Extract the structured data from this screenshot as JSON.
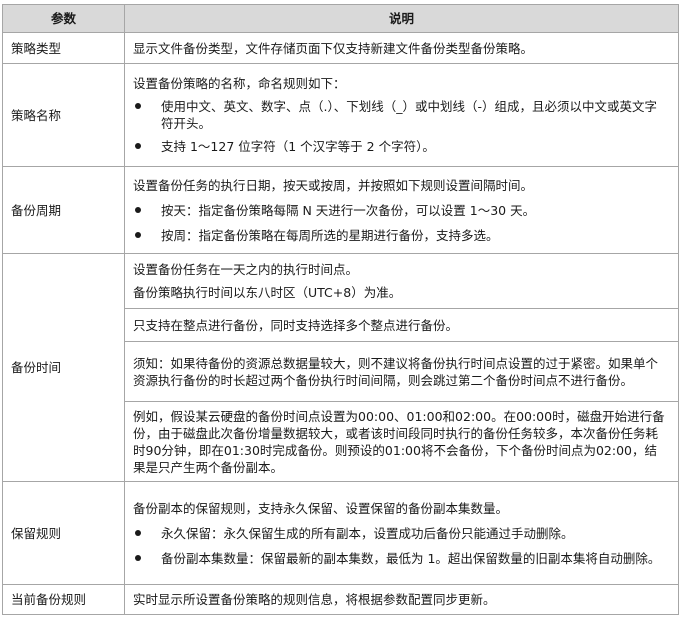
{
  "table": {
    "headers": [
      "参数",
      "说明"
    ],
    "rows": [
      {
        "param": "策略类型",
        "desc": "显示文件备份类型，文件存储页面下仅支持新建文件备份类型备份策略。"
      },
      {
        "param": "策略名称",
        "intro": "设置备份策略的名称，命名规则如下：",
        "bullets": [
          "使用中文、英文、数字、点（.）、下划线（_）或中划线（-）组成，且必须以中文或英文字符开头。",
          "支持 1～127 位字符（1 个汉字等于 2 个字符）。"
        ]
      },
      {
        "param": "备份周期",
        "intro": "设置备份任务的执行日期，按天或按周，并按照如下规则设置间隔时间。",
        "bullets": [
          "按天：指定备份策略每隔 N 天进行一次备份，可以设置 1～30 天。",
          "按周：指定备份策略在每周所选的星期进行备份，支持多选。"
        ]
      },
      {
        "param": "备份时间",
        "sub1_line1": "设置备份任务在一天之内的执行时间点。",
        "sub1_line2": "备份策略执行时间以东八时区（UTC+8）为准。",
        "sub2": "只支持在整点进行备份，同时支持选择多个整点进行备份。",
        "note": "须知：如果待备份的资源总数据量较大，则不建议将备份执行时间点设置的过于紧密。如果单个资源执行备份的时长超过两个备份执行时间间隔，则会跳过第二个备份时间点不进行备份。",
        "example": "例如，假设某云硬盘的备份时间点设置为00:00、01:00和02:00。在00:00时，磁盘开始进行备份，由于磁盘此次备份增量数据较大，或者该时间段同时执行的备份任务较多，本次备份任务耗时90分钟，即在01:30时完成备份。则预设的01:00将不会备份，下个备份时间点为02:00，结果是只产生两个备份副本。"
      },
      {
        "param": "保留规则",
        "intro": "备份副本的保留规则，支持永久保留、设置保留的备份副本集数量。",
        "bullets": [
          "永久保留：永久保留生成的所有副本，设置成功后备份只能通过手动删除。",
          "备份副本集数量：保留最新的副本集数，最低为 1。超出保留数量的旧副本集将自动删除。"
        ]
      },
      {
        "param": "当前备份规则",
        "desc": "实时显示所设置备份策略的规则信息，将根据参数配置同步更新。"
      }
    ]
  }
}
